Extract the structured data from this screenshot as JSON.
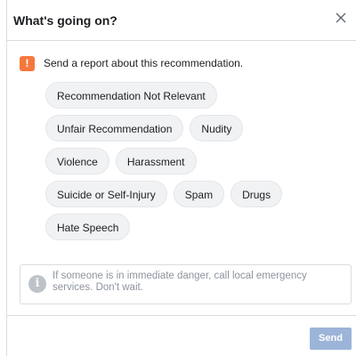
{
  "dialog": {
    "title": "What's going on?",
    "report_text": "Send a report about this recommendation.",
    "chip_rows": [
      [
        "Recommendation Not Relevant"
      ],
      [
        "Unfair Recommendation",
        "Nudity"
      ],
      [
        "Violence",
        "Harassment"
      ],
      [
        "Suicide or Self-Injury",
        "Spam",
        "Drugs"
      ],
      [
        "Hate Speech"
      ]
    ],
    "info": {
      "icon": "i",
      "text": "If someone is in immediate danger, call local emergency services. Don't wait."
    },
    "send_label": "Send",
    "flag_icon": "!"
  },
  "colors": {
    "accent_flag": "#f5783d",
    "send_disabled": "#9cb4d8",
    "chip_bg": "#f1f2f4",
    "border": "#dadde1"
  }
}
